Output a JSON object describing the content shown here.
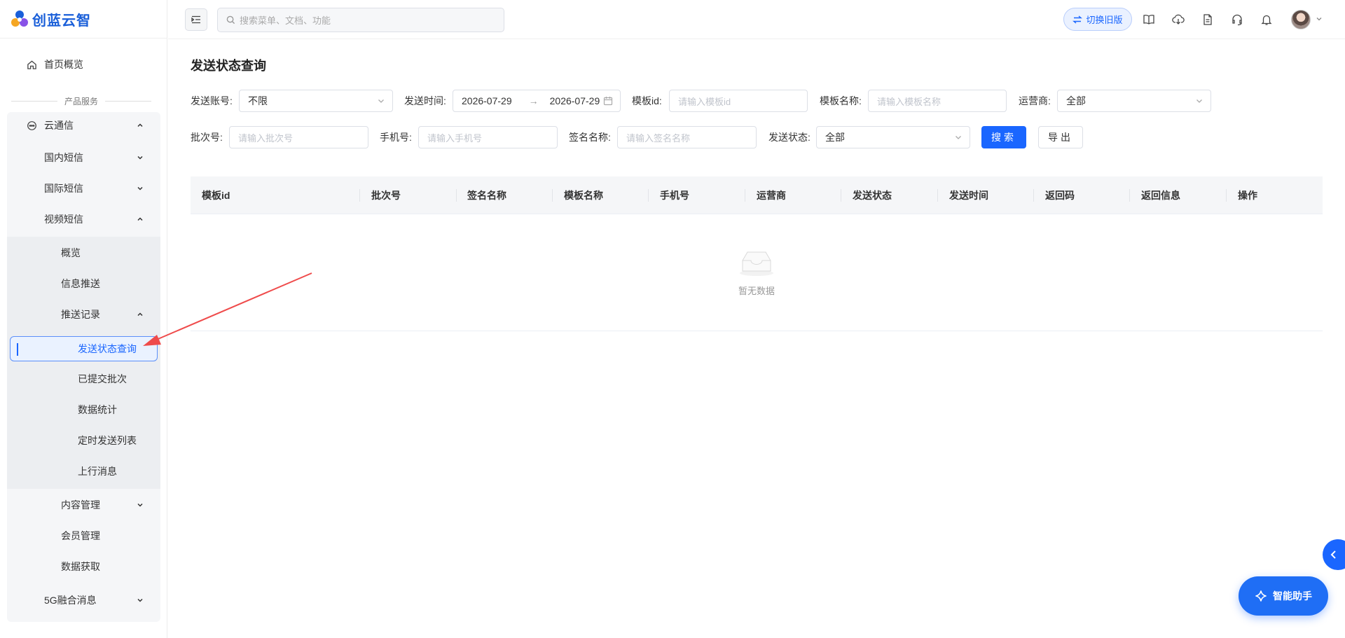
{
  "brand": {
    "name": "创蓝云智"
  },
  "sidebar": {
    "home": "首页概览",
    "section_title": "产品服务",
    "cloud": "云通信",
    "domestic": "国内短信",
    "international": "国际短信",
    "video": "视频短信",
    "overview": "概览",
    "push": "信息推送",
    "records": "推送记录",
    "status_query": "发送状态查询",
    "submitted": "已提交批次",
    "stats": "数据统计",
    "scheduled": "定时发送列表",
    "upstream": "上行消息",
    "content": "内容管理",
    "member": "会员管理",
    "data_fetch": "数据获取",
    "fiveg": "5G融合消息"
  },
  "header": {
    "search_placeholder": "搜索菜单、文档、功能",
    "switch_label": "切换旧版"
  },
  "main": {
    "title": "发送状态查询",
    "filters": {
      "account_label": "发送账号:",
      "account_value": "不限",
      "time_label": "发送时间:",
      "date_start": "2026-07-29",
      "date_end": "2026-07-29",
      "template_id_label": "模板id:",
      "template_id_placeholder": "请输入模板id",
      "template_name_label": "模板名称:",
      "template_name_placeholder": "请输入模板名称",
      "carrier_label": "运营商:",
      "carrier_value": "全部",
      "batch_label": "批次号:",
      "batch_placeholder": "请输入批次号",
      "phone_label": "手机号:",
      "phone_placeholder": "请输入手机号",
      "sign_label": "签名名称:",
      "sign_placeholder": "请输入签名名称",
      "status_label": "发送状态:",
      "status_value": "全部"
    },
    "search_button": "搜索",
    "export_button": "导出",
    "table": {
      "columns": [
        "模板id",
        "批次号",
        "签名名称",
        "模板名称",
        "手机号",
        "运营商",
        "发送状态",
        "发送时间",
        "返回码",
        "返回信息",
        "操作"
      ],
      "empty_text": "暂无数据"
    }
  },
  "assistant": {
    "label": "智能助手"
  },
  "colors": {
    "primary": "#1a66ff",
    "annotation_arrow": "#ef4b4b"
  }
}
